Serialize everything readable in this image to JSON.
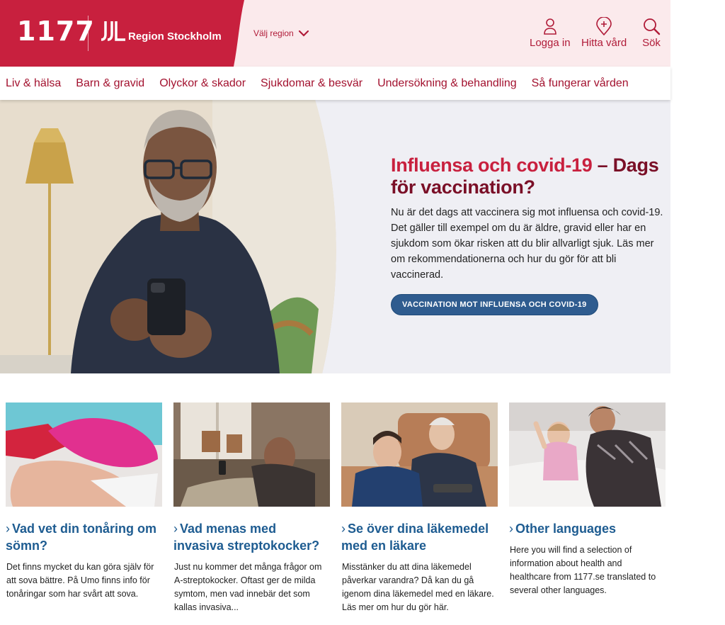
{
  "header": {
    "logo_text": "1177",
    "region_name": "Region Stockholm",
    "region_select_label": "Välj region",
    "actions": [
      {
        "label": "Logga in",
        "icon": "user-icon"
      },
      {
        "label": "Hitta vård",
        "icon": "map-pin-plus-icon"
      },
      {
        "label": "Sök",
        "icon": "search-icon"
      }
    ]
  },
  "nav": {
    "items": [
      "Liv & hälsa",
      "Barn & gravid",
      "Olyckor & skador",
      "Sjukdomar & besvär",
      "Undersökning & behandling",
      "Så fungerar vården"
    ]
  },
  "hero": {
    "title_accent": "Influensa och covid-19",
    "title_rest": " – Dags för vaccination?",
    "text": "Nu är det dags att vaccinera sig mot influensa och covid-19. Det gäller till exempel om du är äldre, gravid eller har en sjukdom som ökar risken att du blir allvarligt sjuk. Läs mer om rekommendationerna och hur du gör för att bli vaccinerad.",
    "button_label": "VACCINATION MOT INFLUENSA OCH COVID-19"
  },
  "cards": [
    {
      "title": "Vad vet din tonåring om sömn?",
      "text": "Det finns mycket du kan göra själv för att sova bättre. På Umo finns info för tonåringar som har svårt att sova."
    },
    {
      "title": "Vad menas med invasiva streptokocker?",
      "text": "Just nu kommer det många frågor om A-streptokocker. Oftast ger de milda symtom, men vad innebär det som kallas invasiva..."
    },
    {
      "title": "Se över dina läkemedel med en läkare",
      "text": "Misstänker du att dina läkemedel påverkar varandra? Då kan du gå igenom dina läkemedel med en läkare. Läs mer om hur du gör här."
    },
    {
      "title": "Other languages",
      "text": "Here you will find a selection of information about health and healthcare from 1177.se translated to several other languages."
    }
  ],
  "colors": {
    "brand_red": "#c8203e",
    "header_bg": "#fbeaec",
    "nav_text": "#a3122f",
    "link_blue": "#1e5c91",
    "button_blue": "#2f5c8f"
  }
}
